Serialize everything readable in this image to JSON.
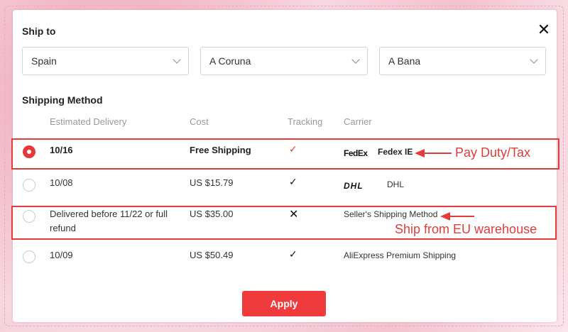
{
  "ship_to": {
    "title": "Ship to",
    "country": "Spain",
    "province": "A Coruna",
    "city": "A Bana"
  },
  "shipping_method": {
    "title": "Shipping Method",
    "columns": [
      "Estimated Delivery",
      "Cost",
      "Tracking",
      "Carrier"
    ],
    "rows": [
      {
        "delivery": "10/16",
        "cost": "Free Shipping",
        "tracking": "✓",
        "carrier_logo": "FedEx",
        "carrier": "Fedex IE",
        "selected": true
      },
      {
        "delivery": "10/08",
        "cost": "US $15.79",
        "tracking": "✓",
        "carrier_logo": "DHL",
        "carrier": "DHL",
        "selected": false
      },
      {
        "delivery": "Delivered before 11/22 or full refund",
        "cost": "US $35.00",
        "tracking": "✕",
        "carrier_logo": "",
        "carrier": "Seller's Shipping Method",
        "selected": false
      },
      {
        "delivery": "10/09",
        "cost": "US $50.49",
        "tracking": "✓",
        "carrier_logo": "",
        "carrier": "AliExpress Premium Shipping",
        "selected": false
      }
    ]
  },
  "annotations": {
    "row1": "Pay Duty/Tax",
    "row3": "Ship from EU warehouse"
  },
  "apply_label": "Apply",
  "close_icon": "close-icon",
  "colors": {
    "accent": "#ef3b3b",
    "annotation": "#e03c3c"
  }
}
